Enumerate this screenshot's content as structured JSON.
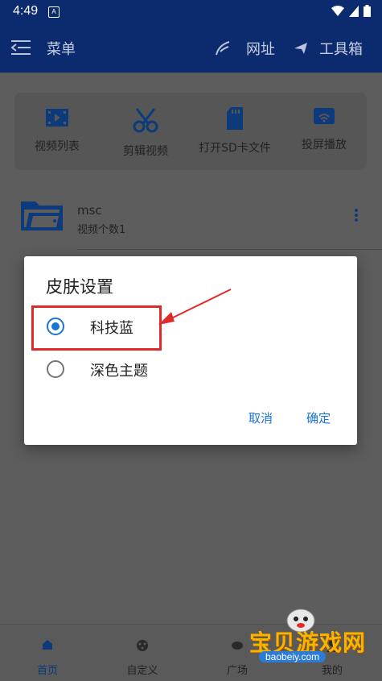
{
  "status_bar": {
    "time": "4:49",
    "app_indicator": "A"
  },
  "app_bar": {
    "menu_label": "菜单",
    "url_label": "网址",
    "tools_label": "工具箱"
  },
  "quick_actions": [
    {
      "label": "视频列表",
      "icon": "video-list-icon"
    },
    {
      "label": "剪辑视频",
      "icon": "scissors-icon"
    },
    {
      "label": "打开SD卡文件",
      "icon": "sd-card-icon"
    },
    {
      "label": "投屏播放",
      "icon": "cast-icon"
    }
  ],
  "folder": {
    "name": "msc",
    "count": "视频个数1"
  },
  "dialog": {
    "title": "皮肤设置",
    "options": [
      {
        "label": "科技蓝",
        "selected": true
      },
      {
        "label": "深色主题",
        "selected": false
      }
    ],
    "cancel": "取消",
    "confirm": "确定"
  },
  "bottom_nav": [
    {
      "label": "首页",
      "icon": "home-icon"
    },
    {
      "label": "自定义",
      "icon": "custom-icon"
    },
    {
      "label": "广场",
      "icon": "square-icon"
    },
    {
      "label": "我的",
      "icon": "profile-icon"
    }
  ],
  "watermark": {
    "title": "宝贝游戏网",
    "url": "baobeiy.com"
  },
  "colors": {
    "primary": "#0c2a6e",
    "accent": "#1976d2",
    "highlight": "#e02b2b",
    "overlay": "#5a5a5a"
  }
}
